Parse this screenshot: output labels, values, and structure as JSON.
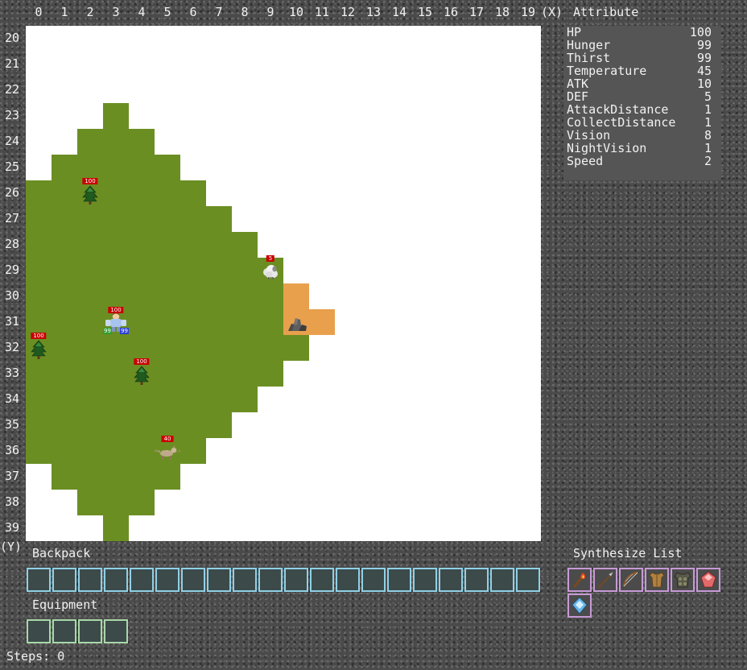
{
  "axes": {
    "x_labels": [
      "0",
      "1",
      "2",
      "3",
      "4",
      "5",
      "6",
      "7",
      "8",
      "9",
      "10",
      "11",
      "12",
      "13",
      "14",
      "15",
      "16",
      "17",
      "18",
      "19"
    ],
    "x_suffix": "(X)",
    "y_labels": [
      "20",
      "21",
      "22",
      "23",
      "24",
      "25",
      "26",
      "27",
      "28",
      "29",
      "30",
      "31",
      "32",
      "33",
      "34",
      "35",
      "36",
      "37",
      "38",
      "39"
    ],
    "y_suffix": "(Y)"
  },
  "attribute": {
    "title": "Attribute",
    "rows": [
      {
        "name": "HP",
        "value": "100"
      },
      {
        "name": "Hunger",
        "value": "99"
      },
      {
        "name": "Thirst",
        "value": "99"
      },
      {
        "name": "Temperature",
        "value": "45"
      },
      {
        "name": "ATK",
        "value": "10"
      },
      {
        "name": "DEF",
        "value": "5"
      },
      {
        "name": "AttackDistance",
        "value": "1"
      },
      {
        "name": "CollectDistance",
        "value": "1"
      },
      {
        "name": "Vision",
        "value": "8"
      },
      {
        "name": "NightVision",
        "value": "1"
      },
      {
        "name": "Speed",
        "value": "2"
      }
    ]
  },
  "map": {
    "grass_rows": [
      [],
      [],
      [],
      [
        3,
        3
      ],
      [
        2,
        4
      ],
      [
        1,
        5
      ],
      [
        0,
        6
      ],
      [
        0,
        7
      ],
      [
        0,
        8
      ],
      [
        0,
        9
      ],
      [
        0,
        9
      ],
      [
        0,
        9
      ],
      [
        0,
        10
      ],
      [
        0,
        9
      ],
      [
        0,
        8
      ],
      [
        0,
        7
      ],
      [
        0,
        6
      ],
      [
        1,
        5
      ],
      [
        2,
        4
      ],
      [
        3,
        3
      ]
    ],
    "sand_tiles": [
      [
        10,
        30
      ],
      [
        10,
        31
      ],
      [
        11,
        31
      ]
    ],
    "entities": [
      {
        "type": "tree",
        "icon": "pine-tree-icon",
        "x": 2,
        "y": 26,
        "hp": "100"
      },
      {
        "type": "tree",
        "icon": "pine-tree-icon",
        "x": 0,
        "y": 32,
        "hp": "100"
      },
      {
        "type": "tree",
        "icon": "pine-tree-icon",
        "x": 4,
        "y": 33,
        "hp": "100"
      },
      {
        "type": "sheep",
        "icon": "sheep-icon",
        "x": 9,
        "y": 29,
        "hp": "5"
      },
      {
        "type": "rock",
        "icon": "rock-icon",
        "x": 10,
        "y": 31
      },
      {
        "type": "wolf",
        "icon": "wolf-icon",
        "x": 5,
        "y": 36,
        "hp": "40"
      }
    ],
    "player": {
      "icon": "player-icon",
      "x": 3,
      "y": 31,
      "hp": "100",
      "hunger": "99",
      "thirst": "99"
    }
  },
  "backpack": {
    "title": "Backpack",
    "slot_count": 20
  },
  "equipment": {
    "title": "Equipment",
    "slot_count": 4
  },
  "synthesize": {
    "title": "Synthesize List",
    "items": [
      {
        "icon": "torch-icon"
      },
      {
        "icon": "spear-icon"
      },
      {
        "icon": "bow-icon"
      },
      {
        "icon": "leather-armor-icon"
      },
      {
        "icon": "stone-armor-icon"
      },
      {
        "icon": "red-gem-icon"
      },
      {
        "icon": "blue-gem-icon"
      }
    ]
  },
  "steps": {
    "label": "Steps:",
    "value": "0"
  }
}
